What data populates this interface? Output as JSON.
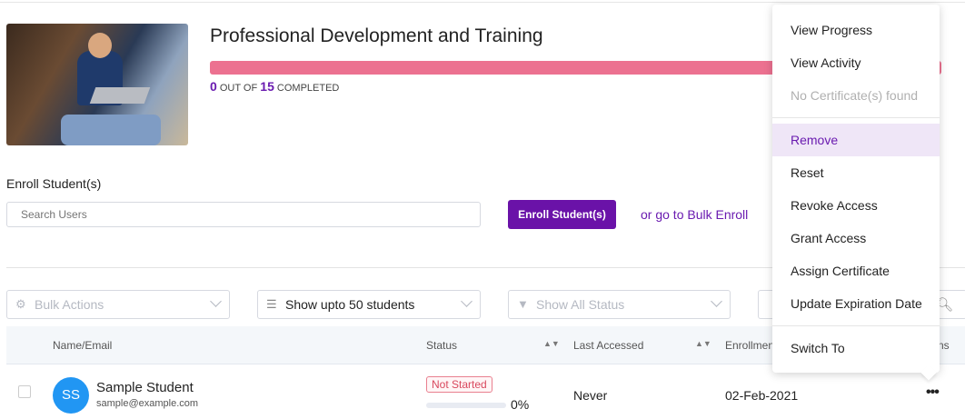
{
  "course": {
    "title": "Professional Development and Training",
    "completed": "0",
    "total": "15",
    "out_of": "out of",
    "completed_label": "completed",
    "progress_percent": 0
  },
  "enroll": {
    "label": "Enroll Student(s)",
    "search_placeholder": "Search Users",
    "button": "Enroll Student(s)",
    "bulk_link": "or go to Bulk Enroll"
  },
  "filters": {
    "bulk_actions": "Bulk Actions",
    "show_upto": "Show upto 50 students",
    "status": "Show All Status"
  },
  "table": {
    "headers": {
      "name": "Name/Email",
      "status": "Status",
      "last_accessed": "Last Accessed",
      "enrollment": "Enrollmen",
      "actions": "ns"
    },
    "rows": [
      {
        "initials": "SS",
        "name": "Sample Student",
        "email": "sample@example.com",
        "status": "Not Started",
        "progress": "0%",
        "last_accessed": "Never",
        "enrollment_date": "02-Feb-2021",
        "avatar_color": "#2196f3"
      }
    ]
  },
  "menu": {
    "items": [
      "View Progress",
      "View Activity",
      "No Certificate(s) found",
      "Remove",
      "Reset",
      "Revoke Access",
      "Grant Access",
      "Assign Certificate",
      "Update Expiration Date",
      "Switch To"
    ]
  },
  "colors": {
    "accent": "#6a12a8",
    "progress": "#ec7190"
  }
}
